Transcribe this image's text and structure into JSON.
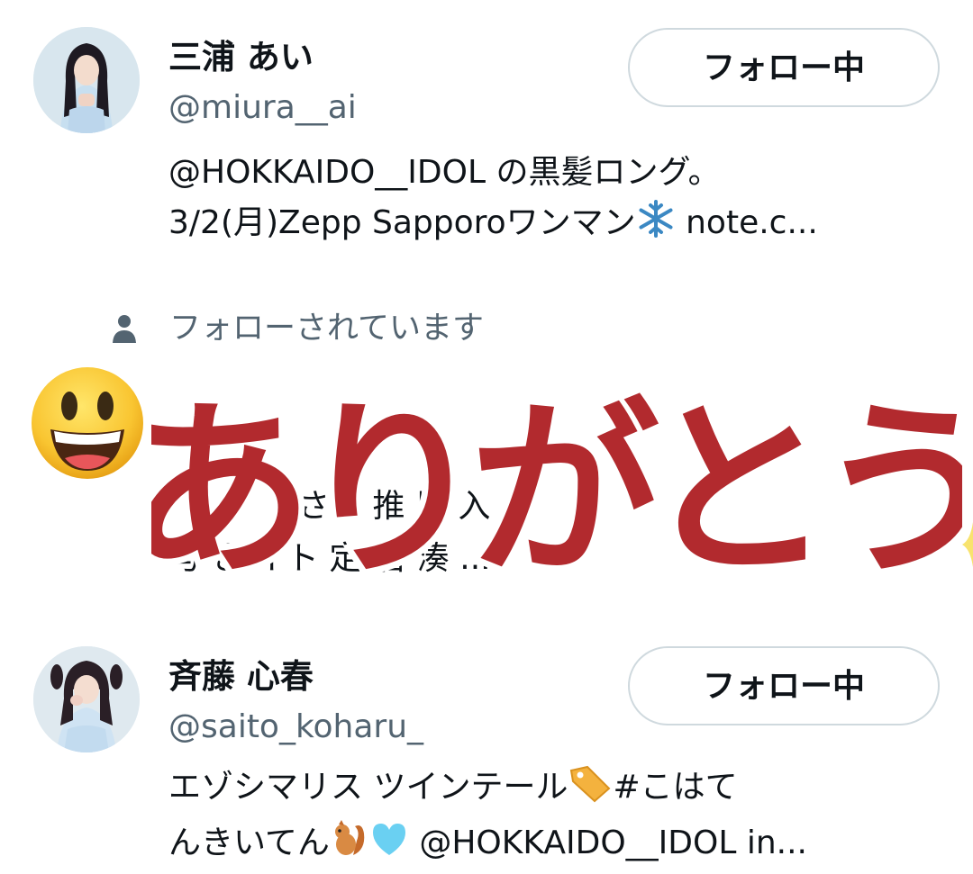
{
  "users": [
    {
      "name": "三浦 あい",
      "handle": "@miura__ai",
      "follow_label": "フォロー中",
      "bio_line1": "@HOKKAIDO__IDOL の黒髪ロング。",
      "bio_line2_pre": "3/2(月)Zepp Sapporoワンマン",
      "bio_line2_post": " note.c...",
      "bio_emoji": "snowflake-icon"
    },
    {
      "social_context": "フォローされています",
      "bio_line1": "さん 推 展 入",
      "bio_line2": "与 き イト 定(名 湊 ..."
    },
    {
      "name": "斉藤 心春",
      "handle": "@saito_koharu_",
      "follow_label": "フォロー中",
      "bio_line1_pre": "エゾシマリス ツインテール",
      "bio_line1_post": "#こはて",
      "bio_line2_pre": "んきいてん",
      "bio_line2_post": " @HOKKAIDO__IDOL in...",
      "bio_emojis": [
        "label-tag-icon",
        "chipmunk-icon",
        "light-blue-heart-icon"
      ]
    }
  ],
  "sticker": {
    "text": "ありがとう",
    "color": "#b22a2e",
    "outline": "#ffffff"
  },
  "emoji_overlay": "grinning-face-icon",
  "colors": {
    "text": "#0f1419",
    "secondary": "#536471",
    "button_border": "#cfd9de"
  }
}
